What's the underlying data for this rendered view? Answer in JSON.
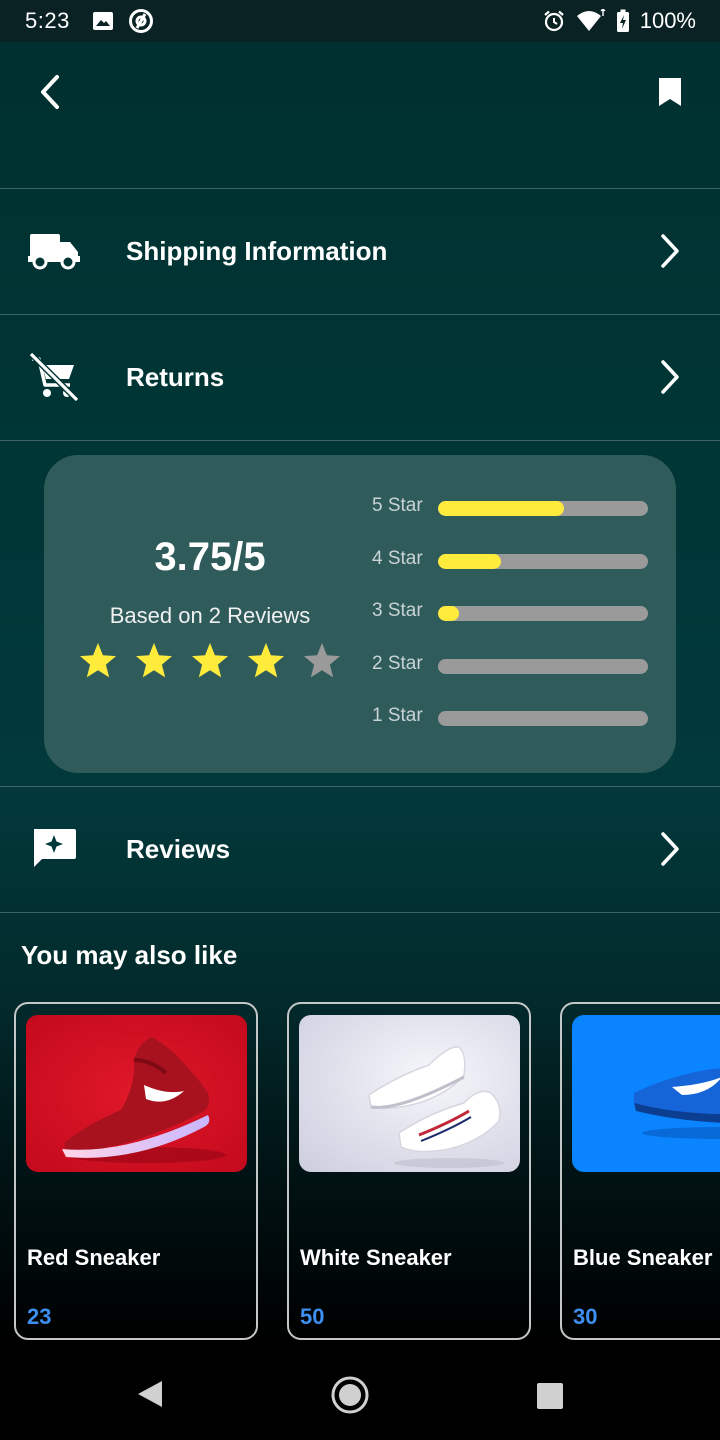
{
  "status_bar": {
    "time": "5:23",
    "battery": "100%",
    "icons": [
      "image-icon",
      "at-icon",
      "alarm-icon",
      "wifi-icon",
      "battery-charging-icon"
    ]
  },
  "app_bar": {
    "back_icon": "chevron-left-icon",
    "bookmark_icon": "bookmark-icon"
  },
  "menu": {
    "shipping": {
      "label": "Shipping Information",
      "icon": "truck-icon"
    },
    "returns": {
      "label": "Returns",
      "icon": "remove-cart-icon"
    },
    "reviews": {
      "label": "Reviews",
      "icon": "review-icon"
    }
  },
  "rating": {
    "score": "3.75/5",
    "based_on": "Based on 2 Reviews",
    "stars_filled": 4,
    "stars_total": 5,
    "breakdown": [
      {
        "label": "5 Star",
        "fraction": 0.6
      },
      {
        "label": "4 Star",
        "fraction": 0.3
      },
      {
        "label": "3 Star",
        "fraction": 0.1
      },
      {
        "label": "2 Star",
        "fraction": 0
      },
      {
        "label": "1 Star",
        "fraction": 0
      }
    ],
    "colors": {
      "filled": "#ffeb3b",
      "empty": "#9a9a9a"
    }
  },
  "recommendations": {
    "title": "You may also like",
    "products": [
      {
        "name": "Red Sneaker",
        "price": "23"
      },
      {
        "name": "White Sneaker",
        "price": "50"
      },
      {
        "name": "Blue Sneaker",
        "price": "30"
      }
    ]
  },
  "colors": {
    "price": "#3d8ef0",
    "background": "#003535"
  }
}
